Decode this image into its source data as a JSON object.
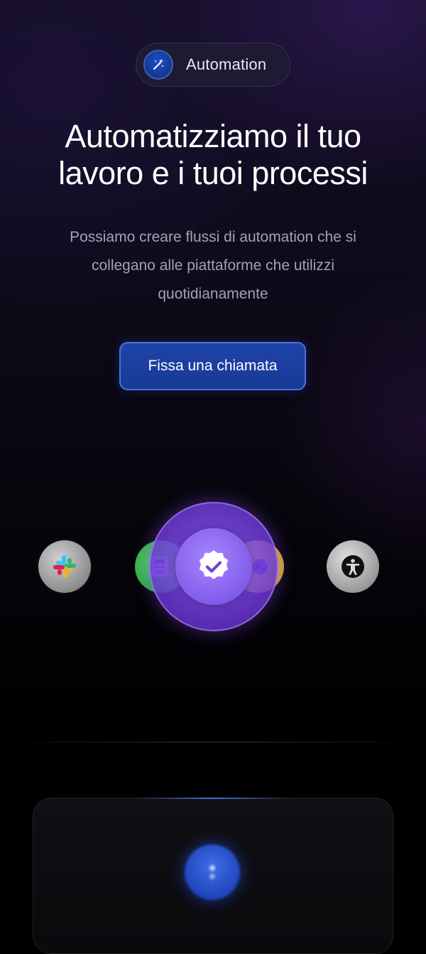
{
  "badge": {
    "label": "Automation",
    "icon": "magic-wand-icon"
  },
  "hero": {
    "title_line1": "Automatizziamo il tuo",
    "title_line2": "lavoro e i tuoi processi",
    "subtitle_line1": "Possiamo creare flussi di automation che si",
    "subtitle_line2": "collegano alle piattaforme che utilizzi",
    "subtitle_line3": "quotidianamente",
    "cta_label": "Fissa una chiamata"
  },
  "integrations": [
    {
      "icon": "slack-icon"
    },
    {
      "icon": "calculator-icon"
    },
    {
      "icon": "verified-check-icon"
    },
    {
      "icon": "globe-icon"
    },
    {
      "icon": "accessibility-icon"
    }
  ],
  "colors": {
    "accent_blue": "#1f43a8",
    "hub_purple": "#7c56e6",
    "green_app": "#2fb84a",
    "yellow_app": "#e3c335"
  }
}
